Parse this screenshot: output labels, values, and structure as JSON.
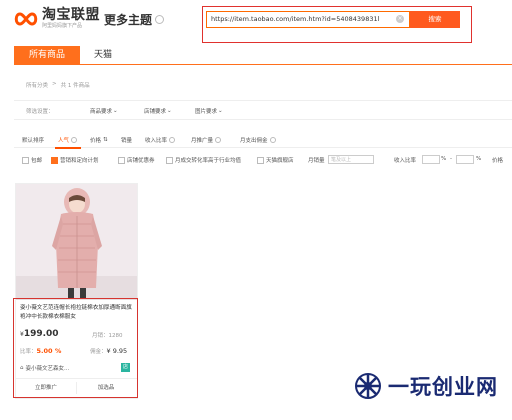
{
  "header": {
    "logo_title": "淘宝联盟",
    "logo_sub": "阿里妈妈旗下产品",
    "more_themes": "更多主题",
    "search_value": "https://item.taobao.com/item.htm?id=5408439831l",
    "search_button": "搜索"
  },
  "tabs": [
    {
      "label": "所有商品",
      "active": true
    },
    {
      "label": "天猫",
      "active": false
    }
  ],
  "breadcrumb": {
    "root": "所有分类",
    "separator": ">",
    "count": "共 1 件商品"
  },
  "filters": {
    "label": "筛选设置：",
    "items": [
      "商品要求",
      "店铺要求",
      "图片要求"
    ]
  },
  "sort": {
    "items": [
      "默认排序",
      "人气",
      "价格",
      "销量",
      "收入比率",
      "月推广量",
      "月支出佣金"
    ]
  },
  "checks": {
    "items": [
      "包邮",
      "营销和定向计划",
      "店铺优惠券",
      "月成交转化率高于行业均值",
      "天猫旗舰店"
    ],
    "monthly_sales_label": "月销量",
    "monthly_sales_placeholder": "笔及以上",
    "income_ratio_label": "收入比率",
    "percent": "%",
    "dash": "-",
    "price_label": "价格"
  },
  "product": {
    "title": "姿小薇文艺范连帽长袍拉链棉衣加厚通断面旗袍冲中长款棉衣棉服女",
    "price_currency": "¥",
    "price_value": "199.00",
    "sales_label": "月销：",
    "sales_value": "1280",
    "ratio_label": "比率：",
    "ratio_value": "5.00 %",
    "commission_label": "佣金：",
    "commission_value": "¥ 9.95",
    "shop_name": "姿小薇文艺森女...",
    "shop_badge": "店",
    "btn_promote": "立即推广",
    "btn_select": "加选品"
  },
  "watermark": {
    "text": "一玩创业网",
    "color": "#1a2a72"
  },
  "colors": {
    "accent": "#ff6f1c",
    "highlight_border": "#d6342f",
    "search_btn": "#ff5a1f"
  }
}
